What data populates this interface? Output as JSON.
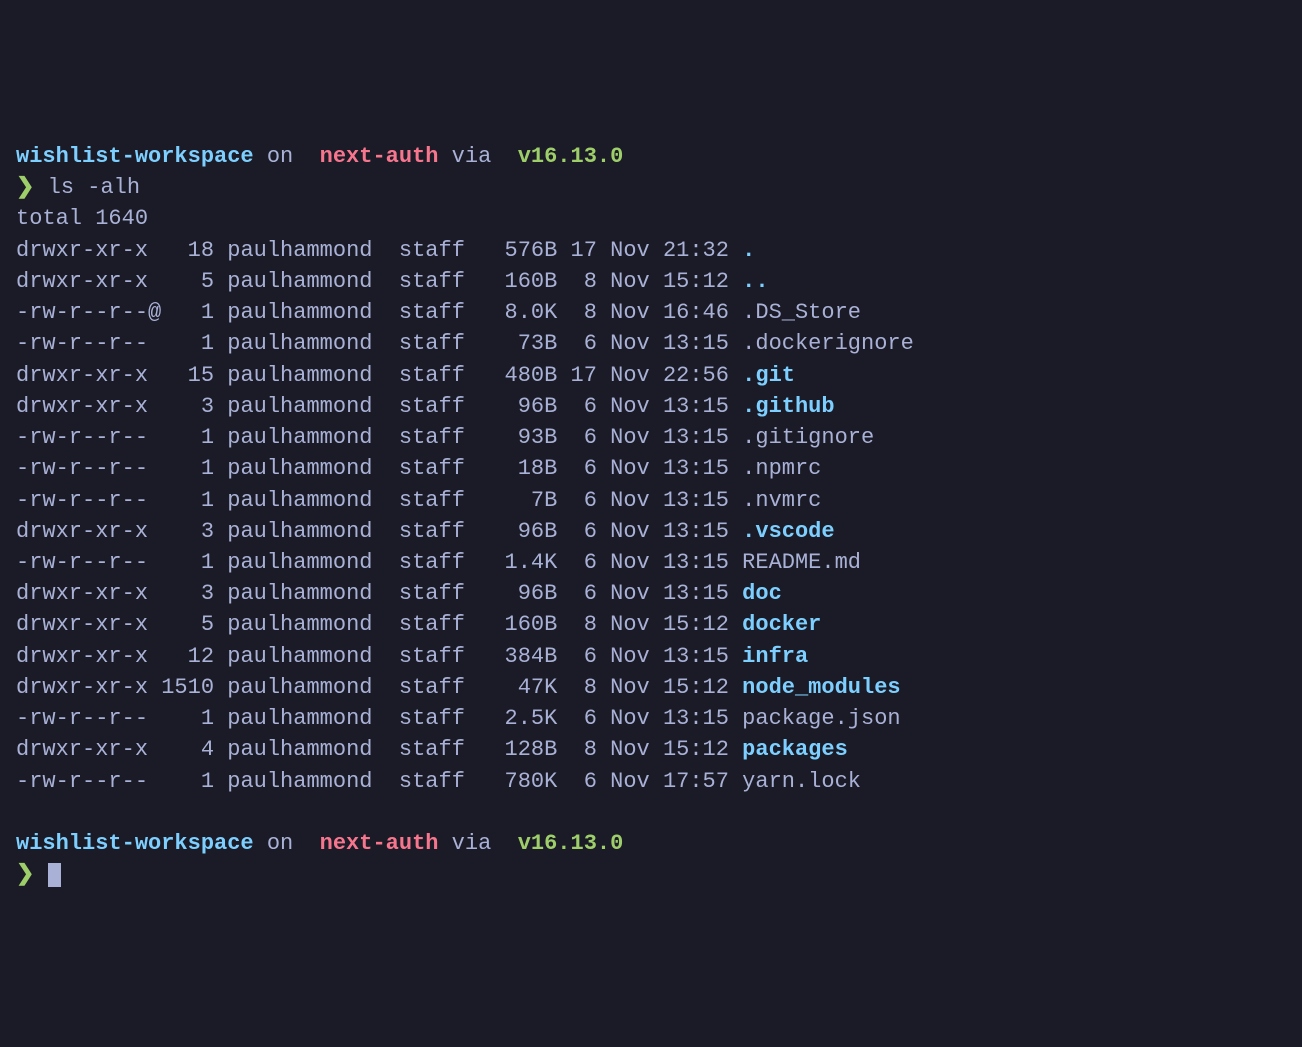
{
  "prompt1": {
    "workspace": "wishlist-workspace",
    "on": " on ",
    "branch_icon": "",
    "branch": " next-auth",
    "via": " via ",
    "node_icon": "",
    "node_version": " v16.13.0",
    "prompt_char": "❯ ",
    "command": "ls -alh"
  },
  "output": {
    "total": "total 1640",
    "rows": [
      {
        "perms": "drwxr-xr-x ",
        "links": "  18",
        "owner": " paulhammond ",
        "group": " staff ",
        "size": "  576B",
        "date": " 17 Nov 21:32 ",
        "name": ".",
        "isdir": true
      },
      {
        "perms": "drwxr-xr-x ",
        "links": "   5",
        "owner": " paulhammond ",
        "group": " staff ",
        "size": "  160B",
        "date": "  8 Nov 15:12 ",
        "name": "..",
        "isdir": true
      },
      {
        "perms": "-rw-r--r--@",
        "links": "   1",
        "owner": " paulhammond ",
        "group": " staff ",
        "size": "  8.0K",
        "date": "  8 Nov 16:46 ",
        "name": ".DS_Store",
        "isdir": false
      },
      {
        "perms": "-rw-r--r-- ",
        "links": "   1",
        "owner": " paulhammond ",
        "group": " staff ",
        "size": "   73B",
        "date": "  6 Nov 13:15 ",
        "name": ".dockerignore",
        "isdir": false
      },
      {
        "perms": "drwxr-xr-x ",
        "links": "  15",
        "owner": " paulhammond ",
        "group": " staff ",
        "size": "  480B",
        "date": " 17 Nov 22:56 ",
        "name": ".git",
        "isdir": true
      },
      {
        "perms": "drwxr-xr-x ",
        "links": "   3",
        "owner": " paulhammond ",
        "group": " staff ",
        "size": "   96B",
        "date": "  6 Nov 13:15 ",
        "name": ".github",
        "isdir": true
      },
      {
        "perms": "-rw-r--r-- ",
        "links": "   1",
        "owner": " paulhammond ",
        "group": " staff ",
        "size": "   93B",
        "date": "  6 Nov 13:15 ",
        "name": ".gitignore",
        "isdir": false
      },
      {
        "perms": "-rw-r--r-- ",
        "links": "   1",
        "owner": " paulhammond ",
        "group": " staff ",
        "size": "   18B",
        "date": "  6 Nov 13:15 ",
        "name": ".npmrc",
        "isdir": false
      },
      {
        "perms": "-rw-r--r-- ",
        "links": "   1",
        "owner": " paulhammond ",
        "group": " staff ",
        "size": "    7B",
        "date": "  6 Nov 13:15 ",
        "name": ".nvmrc",
        "isdir": false
      },
      {
        "perms": "drwxr-xr-x ",
        "links": "   3",
        "owner": " paulhammond ",
        "group": " staff ",
        "size": "   96B",
        "date": "  6 Nov 13:15 ",
        "name": ".vscode",
        "isdir": true
      },
      {
        "perms": "-rw-r--r-- ",
        "links": "   1",
        "owner": " paulhammond ",
        "group": " staff ",
        "size": "  1.4K",
        "date": "  6 Nov 13:15 ",
        "name": "README.md",
        "isdir": false
      },
      {
        "perms": "drwxr-xr-x ",
        "links": "   3",
        "owner": " paulhammond ",
        "group": " staff ",
        "size": "   96B",
        "date": "  6 Nov 13:15 ",
        "name": "doc",
        "isdir": true
      },
      {
        "perms": "drwxr-xr-x ",
        "links": "   5",
        "owner": " paulhammond ",
        "group": " staff ",
        "size": "  160B",
        "date": "  8 Nov 15:12 ",
        "name": "docker",
        "isdir": true
      },
      {
        "perms": "drwxr-xr-x ",
        "links": "  12",
        "owner": " paulhammond ",
        "group": " staff ",
        "size": "  384B",
        "date": "  6 Nov 13:15 ",
        "name": "infra",
        "isdir": true
      },
      {
        "perms": "drwxr-xr-x ",
        "links": "1510",
        "owner": " paulhammond ",
        "group": " staff ",
        "size": "   47K",
        "date": "  8 Nov 15:12 ",
        "name": "node_modules",
        "isdir": true
      },
      {
        "perms": "-rw-r--r-- ",
        "links": "   1",
        "owner": " paulhammond ",
        "group": " staff ",
        "size": "  2.5K",
        "date": "  6 Nov 13:15 ",
        "name": "package.json",
        "isdir": false
      },
      {
        "perms": "drwxr-xr-x ",
        "links": "   4",
        "owner": " paulhammond ",
        "group": " staff ",
        "size": "  128B",
        "date": "  8 Nov 15:12 ",
        "name": "packages",
        "isdir": true
      },
      {
        "perms": "-rw-r--r-- ",
        "links": "   1",
        "owner": " paulhammond ",
        "group": " staff ",
        "size": "  780K",
        "date": "  6 Nov 17:57 ",
        "name": "yarn.lock",
        "isdir": false
      }
    ]
  },
  "prompt2": {
    "workspace": "wishlist-workspace",
    "on": " on ",
    "branch_icon": "",
    "branch": " next-auth",
    "via": " via ",
    "node_icon": "",
    "node_version": " v16.13.0",
    "prompt_char": "❯ "
  }
}
